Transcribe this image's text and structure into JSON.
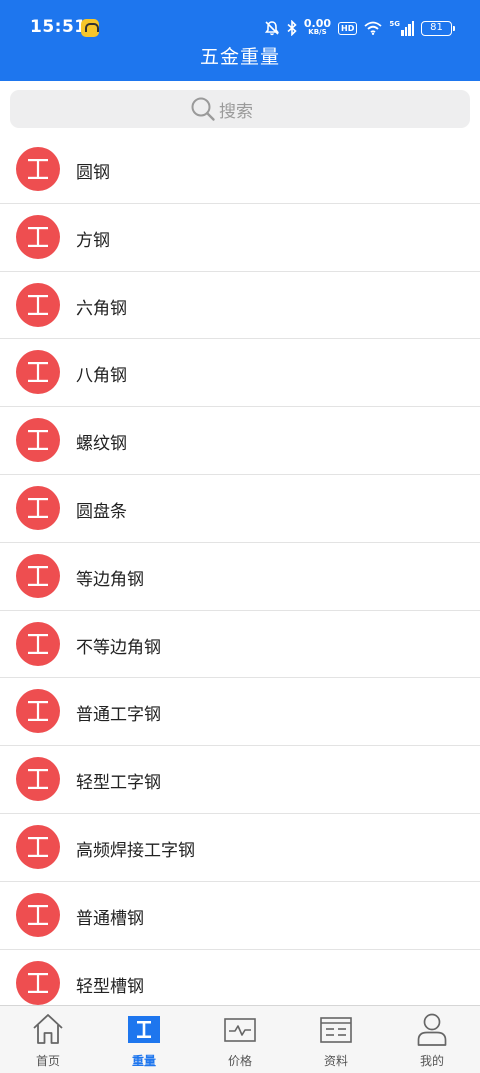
{
  "status_bar": {
    "time": "15:51",
    "speed_value": "0.00",
    "speed_unit": "KB/S",
    "hd": "HD",
    "network": "5G",
    "battery": "81"
  },
  "header": {
    "title": "五金重量"
  },
  "search": {
    "placeholder": "搜索"
  },
  "list": {
    "items": [
      {
        "label": "圆钢"
      },
      {
        "label": "方钢"
      },
      {
        "label": "六角钢"
      },
      {
        "label": "八角钢"
      },
      {
        "label": "螺纹钢"
      },
      {
        "label": "圆盘条"
      },
      {
        "label": "等边角钢"
      },
      {
        "label": "不等边角钢"
      },
      {
        "label": "普通工字钢"
      },
      {
        "label": "轻型工字钢"
      },
      {
        "label": "高频焊接工字钢"
      },
      {
        "label": "普通槽钢"
      },
      {
        "label": "轻型槽钢"
      }
    ]
  },
  "tabbar": {
    "items": [
      {
        "label": "首页",
        "icon": "home-icon"
      },
      {
        "label": "重量",
        "icon": "i-beam-icon",
        "active": true
      },
      {
        "label": "价格",
        "icon": "price-chart-icon"
      },
      {
        "label": "资料",
        "icon": "document-icon"
      },
      {
        "label": "我的",
        "icon": "user-icon"
      }
    ]
  },
  "colors": {
    "primary": "#1e76ee",
    "badge": "#ee4e50",
    "search_bg": "#eeeeef",
    "tabbar_bg": "#f6f6f6"
  }
}
